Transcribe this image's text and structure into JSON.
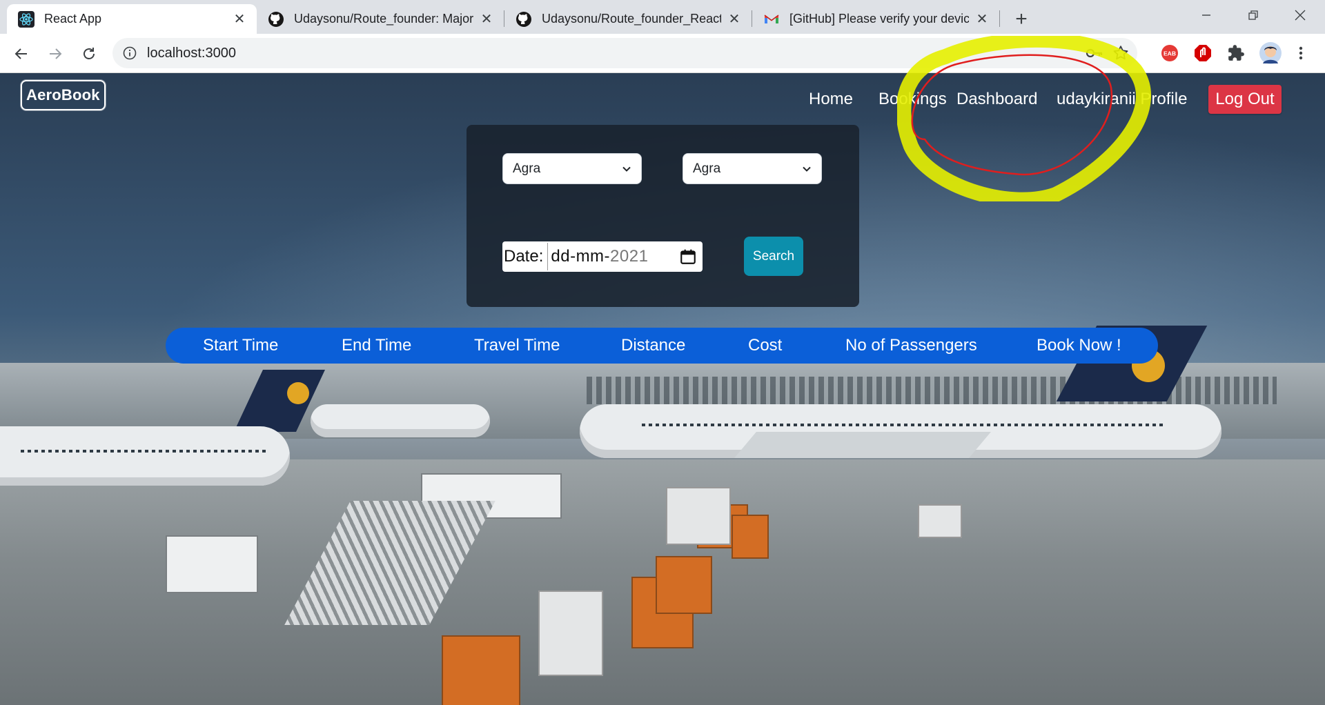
{
  "browser": {
    "tabs": [
      {
        "title": "React App",
        "icon": "react-icon",
        "active": true
      },
      {
        "title": "Udaysonu/Route_founder: Major",
        "icon": "github-icon",
        "active": false
      },
      {
        "title": "Udaysonu/Route_founder_React_",
        "icon": "github-icon",
        "active": false
      },
      {
        "title": "[GitHub] Please verify your device",
        "icon": "gmail-icon",
        "active": false
      }
    ],
    "new_tab": "+",
    "url": "localhost:3000",
    "extensions": [
      {
        "name": "eab-extension-icon",
        "label": "EAB",
        "color": "#e53935"
      },
      {
        "name": "adblock-icon",
        "color": "#d50000"
      },
      {
        "name": "puzzle-extensions-icon"
      },
      {
        "name": "profile-avatar-icon"
      }
    ]
  },
  "app": {
    "brand": "AeroBook",
    "nav": {
      "home": "Home",
      "bookings": "Bookings",
      "dashboard": "Dashboard",
      "profile": "udaykiranii Profile",
      "logout": "Log Out"
    },
    "search": {
      "from_value": "Agra",
      "to_value": "Agra",
      "date_label": "Date:",
      "date_placeholder": "dd-mm-",
      "date_year": "2021",
      "search_label": "Search"
    },
    "results_header": [
      "Start Time",
      "End Time",
      "Travel Time",
      "Distance",
      "Cost",
      "No of Passengers",
      "Book Now !"
    ]
  },
  "colors": {
    "logout": "#dc3545",
    "search_button": "#0c8fac",
    "header_bar": "#0b5fd8",
    "annotation_yellow": "#e6f000",
    "annotation_red": "#e01e1e"
  }
}
